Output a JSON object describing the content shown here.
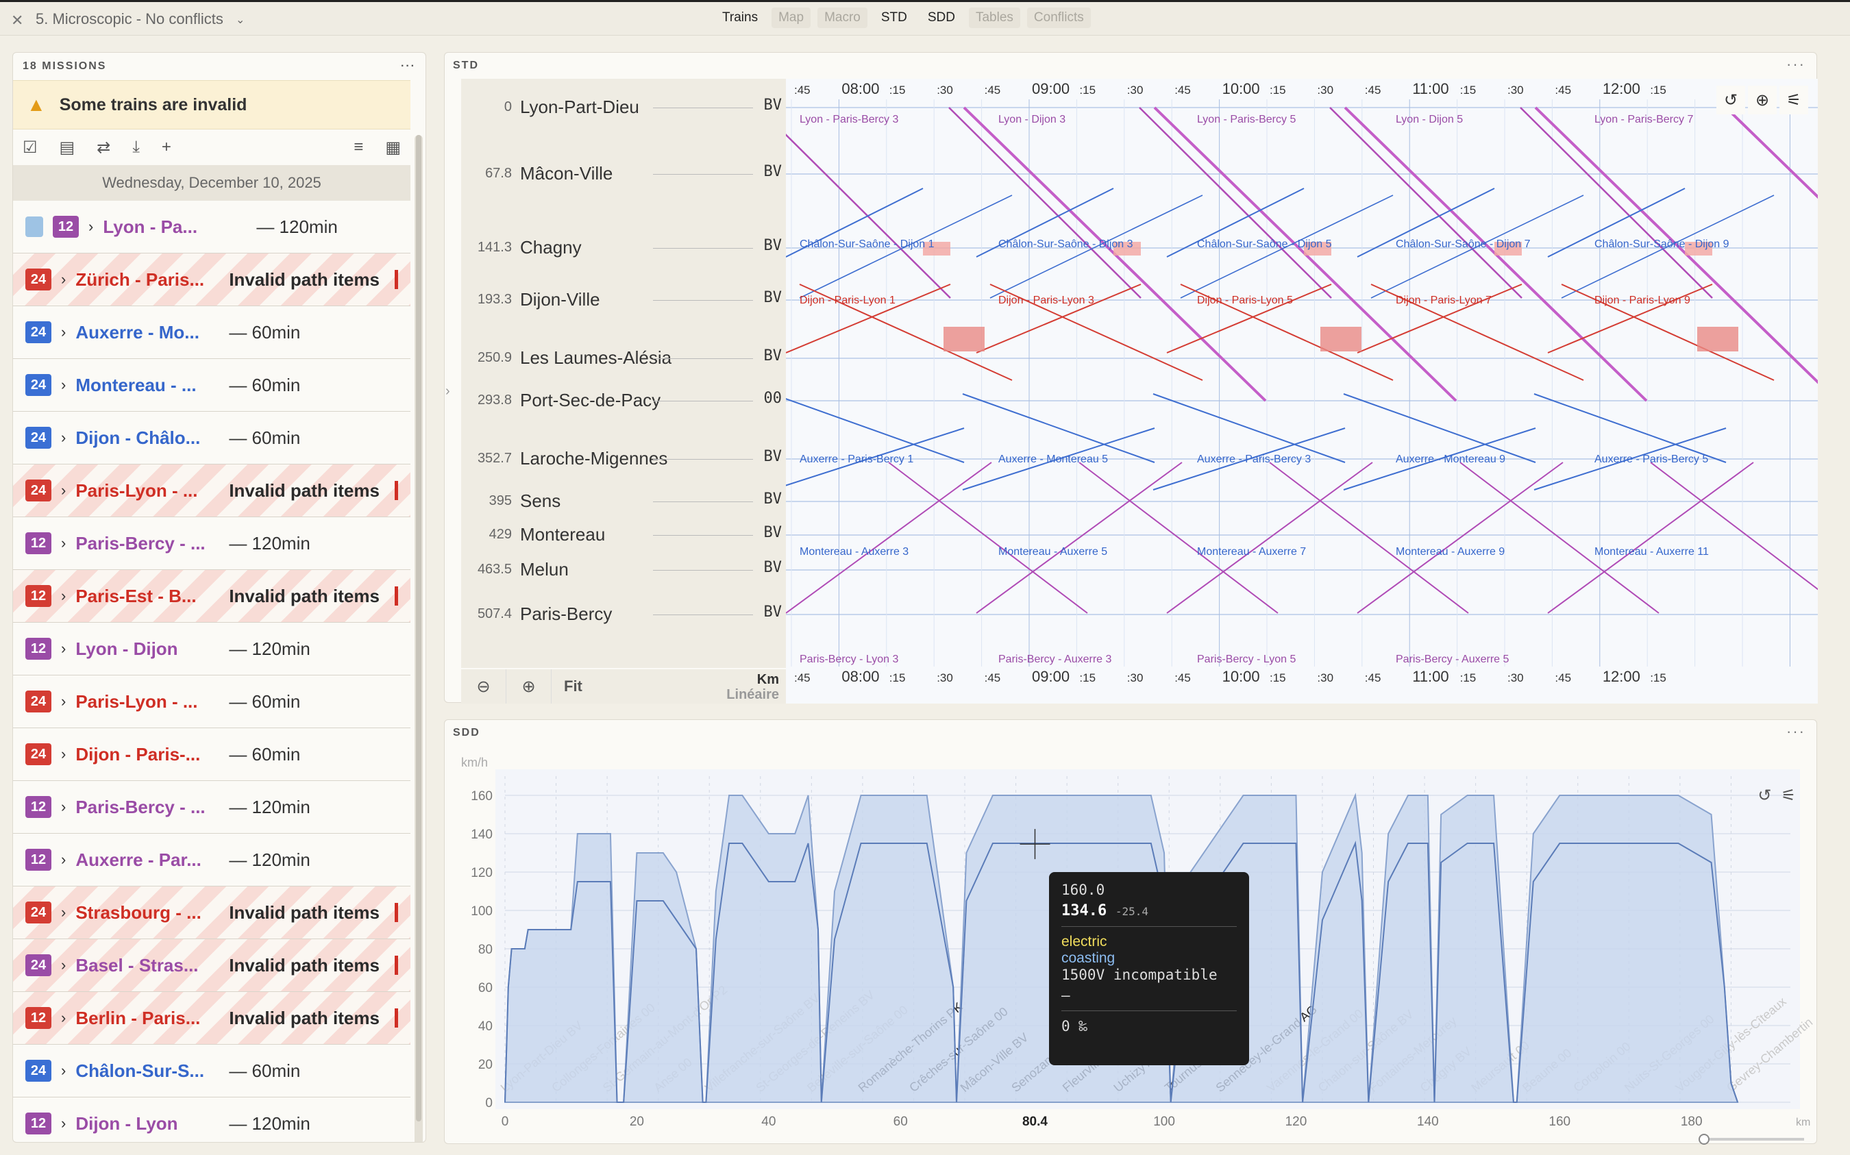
{
  "topbar": {
    "scenario": "5. Microscopic - No conflicts",
    "tabs": [
      {
        "label": "Trains",
        "disabled": false
      },
      {
        "label": "Map",
        "disabled": true
      },
      {
        "label": "Macro",
        "disabled": true
      },
      {
        "label": "STD",
        "disabled": false
      },
      {
        "label": "SDD",
        "disabled": false
      },
      {
        "label": "Tables",
        "disabled": true
      },
      {
        "label": "Conflicts",
        "disabled": true
      }
    ]
  },
  "missions": {
    "title": "18 MISSIONS",
    "warning": "Some trains are invalid",
    "date": "Wednesday, December 10, 2025",
    "trains": [
      {
        "badge": "12",
        "color": "purple",
        "name": "Lyon - Pa...",
        "dur": "— 120min",
        "invalid": false,
        "doc": true
      },
      {
        "badge": "24",
        "color": "red",
        "name": "Zürich - Paris...",
        "dur": "Invalid path items",
        "invalid": true
      },
      {
        "badge": "24",
        "color": "blue",
        "name": "Auxerre - Mo...",
        "dur": "— 60min",
        "invalid": false
      },
      {
        "badge": "24",
        "color": "blue",
        "name": "Montereau - ...",
        "dur": "— 60min",
        "invalid": false
      },
      {
        "badge": "24",
        "color": "blue",
        "name": "Dijon - Châlo...",
        "dur": "— 60min",
        "invalid": false
      },
      {
        "badge": "24",
        "color": "red",
        "name": "Paris-Lyon - ...",
        "dur": "Invalid path items",
        "invalid": true
      },
      {
        "badge": "12",
        "color": "purple",
        "name": "Paris-Bercy - ...",
        "dur": "— 120min",
        "invalid": false
      },
      {
        "badge": "12",
        "color": "red",
        "name": "Paris-Est - B...",
        "dur": "Invalid path items",
        "invalid": true
      },
      {
        "badge": "12",
        "color": "purple",
        "name": "Lyon - Dijon",
        "dur": "— 120min",
        "invalid": false
      },
      {
        "badge": "24",
        "color": "red",
        "name": "Paris-Lyon - ...",
        "dur": "— 60min",
        "invalid": false
      },
      {
        "badge": "24",
        "color": "red",
        "name": "Dijon - Paris-...",
        "dur": "— 60min",
        "invalid": false
      },
      {
        "badge": "12",
        "color": "purple",
        "name": "Paris-Bercy - ...",
        "dur": "— 120min",
        "invalid": false
      },
      {
        "badge": "12",
        "color": "purple",
        "name": "Auxerre - Par...",
        "dur": "— 120min",
        "invalid": false
      },
      {
        "badge": "24",
        "color": "red",
        "name": "Strasbourg - ...",
        "dur": "Invalid path items",
        "invalid": true
      },
      {
        "badge": "24",
        "color": "purple",
        "name": "Basel - Stras...",
        "dur": "Invalid path items",
        "invalid": true
      },
      {
        "badge": "12",
        "color": "red",
        "name": "Berlin - Paris...",
        "dur": "Invalid path items",
        "invalid": true
      },
      {
        "badge": "24",
        "color": "blue",
        "name": "Châlon-Sur-S...",
        "dur": "— 60min",
        "invalid": false
      },
      {
        "badge": "12",
        "color": "purple",
        "name": "Dijon - Lyon",
        "dur": "— 120min",
        "invalid": false
      }
    ]
  },
  "std": {
    "title": "STD",
    "fit_label": "Fit",
    "km_label": "Km",
    "scale_label": "Linéaire",
    "stations": [
      {
        "km": "0",
        "name": "Lyon-Part-Dieu",
        "code": "BV"
      },
      {
        "km": "67.8",
        "name": "Mâcon-Ville",
        "code": "BV"
      },
      {
        "km": "141.3",
        "name": "Chagny",
        "code": "BV"
      },
      {
        "km": "193.3",
        "name": "Dijon-Ville",
        "code": "BV"
      },
      {
        "km": "250.9",
        "name": "Les Laumes-Alésia",
        "code": "BV"
      },
      {
        "km": "293.8",
        "name": "Port-Sec-de-Pacy",
        "code": "00"
      },
      {
        "km": "352.7",
        "name": "Laroche-Migennes",
        "code": "BV"
      },
      {
        "km": "395",
        "name": "Sens",
        "code": "BV"
      },
      {
        "km": "429",
        "name": "Montereau",
        "code": "BV"
      },
      {
        "km": "463.5",
        "name": "Melun",
        "code": "BV"
      },
      {
        "km": "507.4",
        "name": "Paris-Bercy",
        "code": "BV"
      }
    ],
    "time_ticks": [
      ":45",
      "08:00",
      ":15",
      ":30",
      ":45",
      "09:00",
      ":15",
      ":30",
      ":45",
      "10:00",
      ":15",
      ":30",
      ":45",
      "11:00",
      ":15",
      ":30",
      ":45",
      "12:00",
      ":15"
    ],
    "train_labels": {
      "top": [
        "Lyon - Paris-Bercy 3",
        "Lyon - Dijon 3",
        "Lyon - Paris-Bercy 5",
        "Lyon - Dijon 5",
        "Lyon - Paris-Bercy 7"
      ],
      "chalon": [
        "Châlon-Sur-Saône - Dijon 1",
        "Châlon-Sur-Saône - Dijon 3",
        "Châlon-Sur-Saône - Dijon 5",
        "Châlon-Sur-Saône - Dijon 7",
        "Châlon-Sur-Saône - Dijon 9"
      ],
      "dijon": [
        "Dijon - Paris-Lyon 1",
        "Dijon - Paris-Lyon 3",
        "Dijon - Paris-Lyon 5",
        "Dijon - Paris-Lyon 7",
        "Dijon - Paris-Lyon 9"
      ],
      "auxerre": [
        "Auxerre - Paris-Bercy 1",
        "Auxerre - Montereau 5",
        "Auxerre - Paris-Bercy 3",
        "Auxerre - Montereau 9",
        "Auxerre - Paris-Bercy 5"
      ],
      "montereau": [
        "Montereau - Auxerre 3",
        "Montereau - Auxerre 5",
        "Montereau - Auxerre 7",
        "Montereau - Auxerre 9",
        "Montereau - Auxerre 11"
      ],
      "bottom": [
        "Paris-Bercy - Lyon 3",
        "Paris-Bercy - Auxerre 3",
        "Paris-Bercy - Lyon 5",
        "Paris-Bercy - Auxerre 5"
      ]
    }
  },
  "sdd": {
    "title": "SDD",
    "y_unit": "km/h",
    "x_unit": "km",
    "y_ticks": [
      "0",
      "20",
      "40",
      "60",
      "80",
      "100",
      "120",
      "140",
      "160"
    ],
    "x_ticks": [
      "0",
      "20",
      "40",
      "60",
      "80.4",
      "100",
      "120",
      "140",
      "160",
      "180"
    ],
    "station_labels": [
      "Lyon-Part-Dieu BV",
      "Collonges-Fontaines 00",
      "St-Germain-au-Mont-d'Or P2",
      "Anse 00",
      "Villefranche-sur-Saône BV",
      "St-Georges-de-Reneins BV",
      "Belleville-sur-Saône 00",
      "Romanèche-Thorins PK",
      "Crêches-sur-Saône 00",
      "Mâcon-Ville BV",
      "Senozan",
      "Fleurville-Pont-de-Vaux",
      "Uchizy AG",
      "Tournus 00",
      "Sennecey-le-Grand AG",
      "Varennes-le-Grand 00",
      "Chalon-sur-Saône BV",
      "Fontaines-Mercurey",
      "Chagny BV",
      "Meursault 00",
      "Beaune 00",
      "Corgoloin 00",
      "Nuits-St-Georges 00",
      "Vougeot-Gilly-lès-Cîteaux",
      "Gevrey-Chambertin"
    ],
    "tooltip": {
      "max_speed": "160.0",
      "speed": "134.6",
      "delta": "-25.4",
      "mode": "electric",
      "behaviour": "coasting",
      "power": "1500V",
      "compat": "incompatible",
      "dash": "—",
      "gradient": "0 ‰"
    }
  },
  "chart_data": {
    "type": "area",
    "title": "",
    "xlabel": "km",
    "ylabel": "km/h",
    "ylim": [
      0,
      170
    ],
    "xlim": [
      0,
      195
    ],
    "series": [
      {
        "name": "",
        "x": [
          0,
          0.5,
          1,
          3,
          3.5,
          5.5,
          6,
          10,
          11,
          16,
          17,
          18,
          20,
          24,
          26,
          29,
          30,
          30.5,
          32,
          34,
          36,
          40,
          44,
          46,
          47.5,
          48,
          50,
          54,
          58,
          64,
          68,
          68.5,
          70,
          74,
          80,
          90,
          98,
          100,
          101,
          104,
          112,
          118,
          120,
          121,
          124,
          129,
          130,
          131,
          134,
          137,
          140,
          141,
          142,
          146,
          150,
          153,
          153.5,
          156,
          160,
          164,
          170,
          178,
          183,
          185,
          186,
          187
        ],
        "y": [
          0,
          60,
          80,
          80,
          90,
          90,
          90,
          90,
          140,
          140,
          0,
          0,
          130,
          130,
          120,
          80,
          0,
          0,
          110,
          160,
          160,
          140,
          140,
          160,
          90,
          0,
          110,
          160,
          160,
          160,
          60,
          0,
          130,
          160,
          160,
          160,
          160,
          130,
          0,
          120,
          160,
          160,
          160,
          0,
          120,
          160,
          130,
          0,
          140,
          160,
          160,
          0,
          150,
          160,
          160,
          0,
          0,
          140,
          160,
          160,
          160,
          160,
          150,
          60,
          10,
          0
        ]
      }
    ]
  }
}
